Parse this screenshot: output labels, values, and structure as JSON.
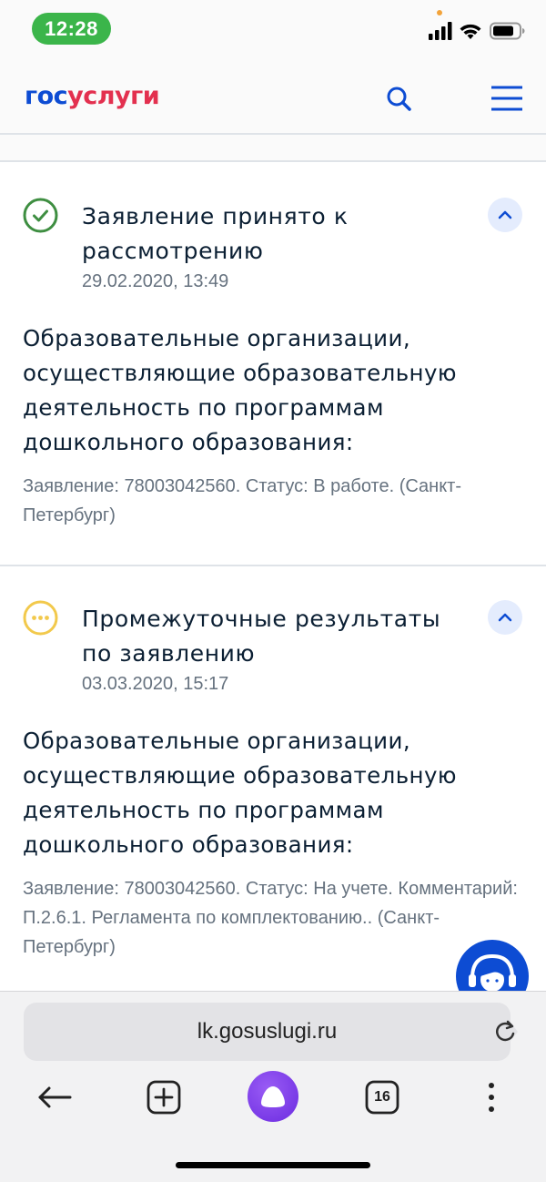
{
  "status_bar": {
    "time": "12:28"
  },
  "header": {
    "logo_part1": "гос",
    "logo_part2": "услуги",
    "search_icon": "search-icon",
    "menu_icon": "hamburger-menu-icon"
  },
  "events": [
    {
      "status_icon": "check-circle-icon",
      "status_color": "#3e8e41",
      "title": "Заявление принято к рассмотрению",
      "date": "29.02.2020, 13:49",
      "body": "Образовательные организации, осуществляющие образовательную деятельность по программам дошкольного образования:",
      "note": "Заявление: 78003042560. Статус: В работе. (Санкт-Петербург)"
    },
    {
      "status_icon": "ellipsis-circle-icon",
      "status_color": "#f2c94c",
      "title": "Промежуточные результаты по заявлению",
      "date": "03.03.2020, 15:17",
      "body": "Образовательные организации, осуществляющие образовательную деятельность по программам дошкольного образования:",
      "note": "Заявление: 78003042560. Статус: На учете. Комментарий: П.2.6.1. Регламента по комплектованию.. (Санкт-Петербург)"
    }
  ],
  "support": {
    "icon": "support-operator-icon"
  },
  "browser": {
    "url": "lk.gosuslugi.ru",
    "tabs_count": "16",
    "back_icon": "back-arrow-icon",
    "new_tab_icon": "plus-square-icon",
    "assistant_icon": "alice-assistant-icon",
    "more_icon": "more-vertical-icon",
    "reload_icon": "reload-icon"
  },
  "colors": {
    "brand_blue": "#0d4cd3",
    "brand_red": "#e3304f",
    "accent_light": "#e4ecfd",
    "text_secondary": "#66727f"
  }
}
